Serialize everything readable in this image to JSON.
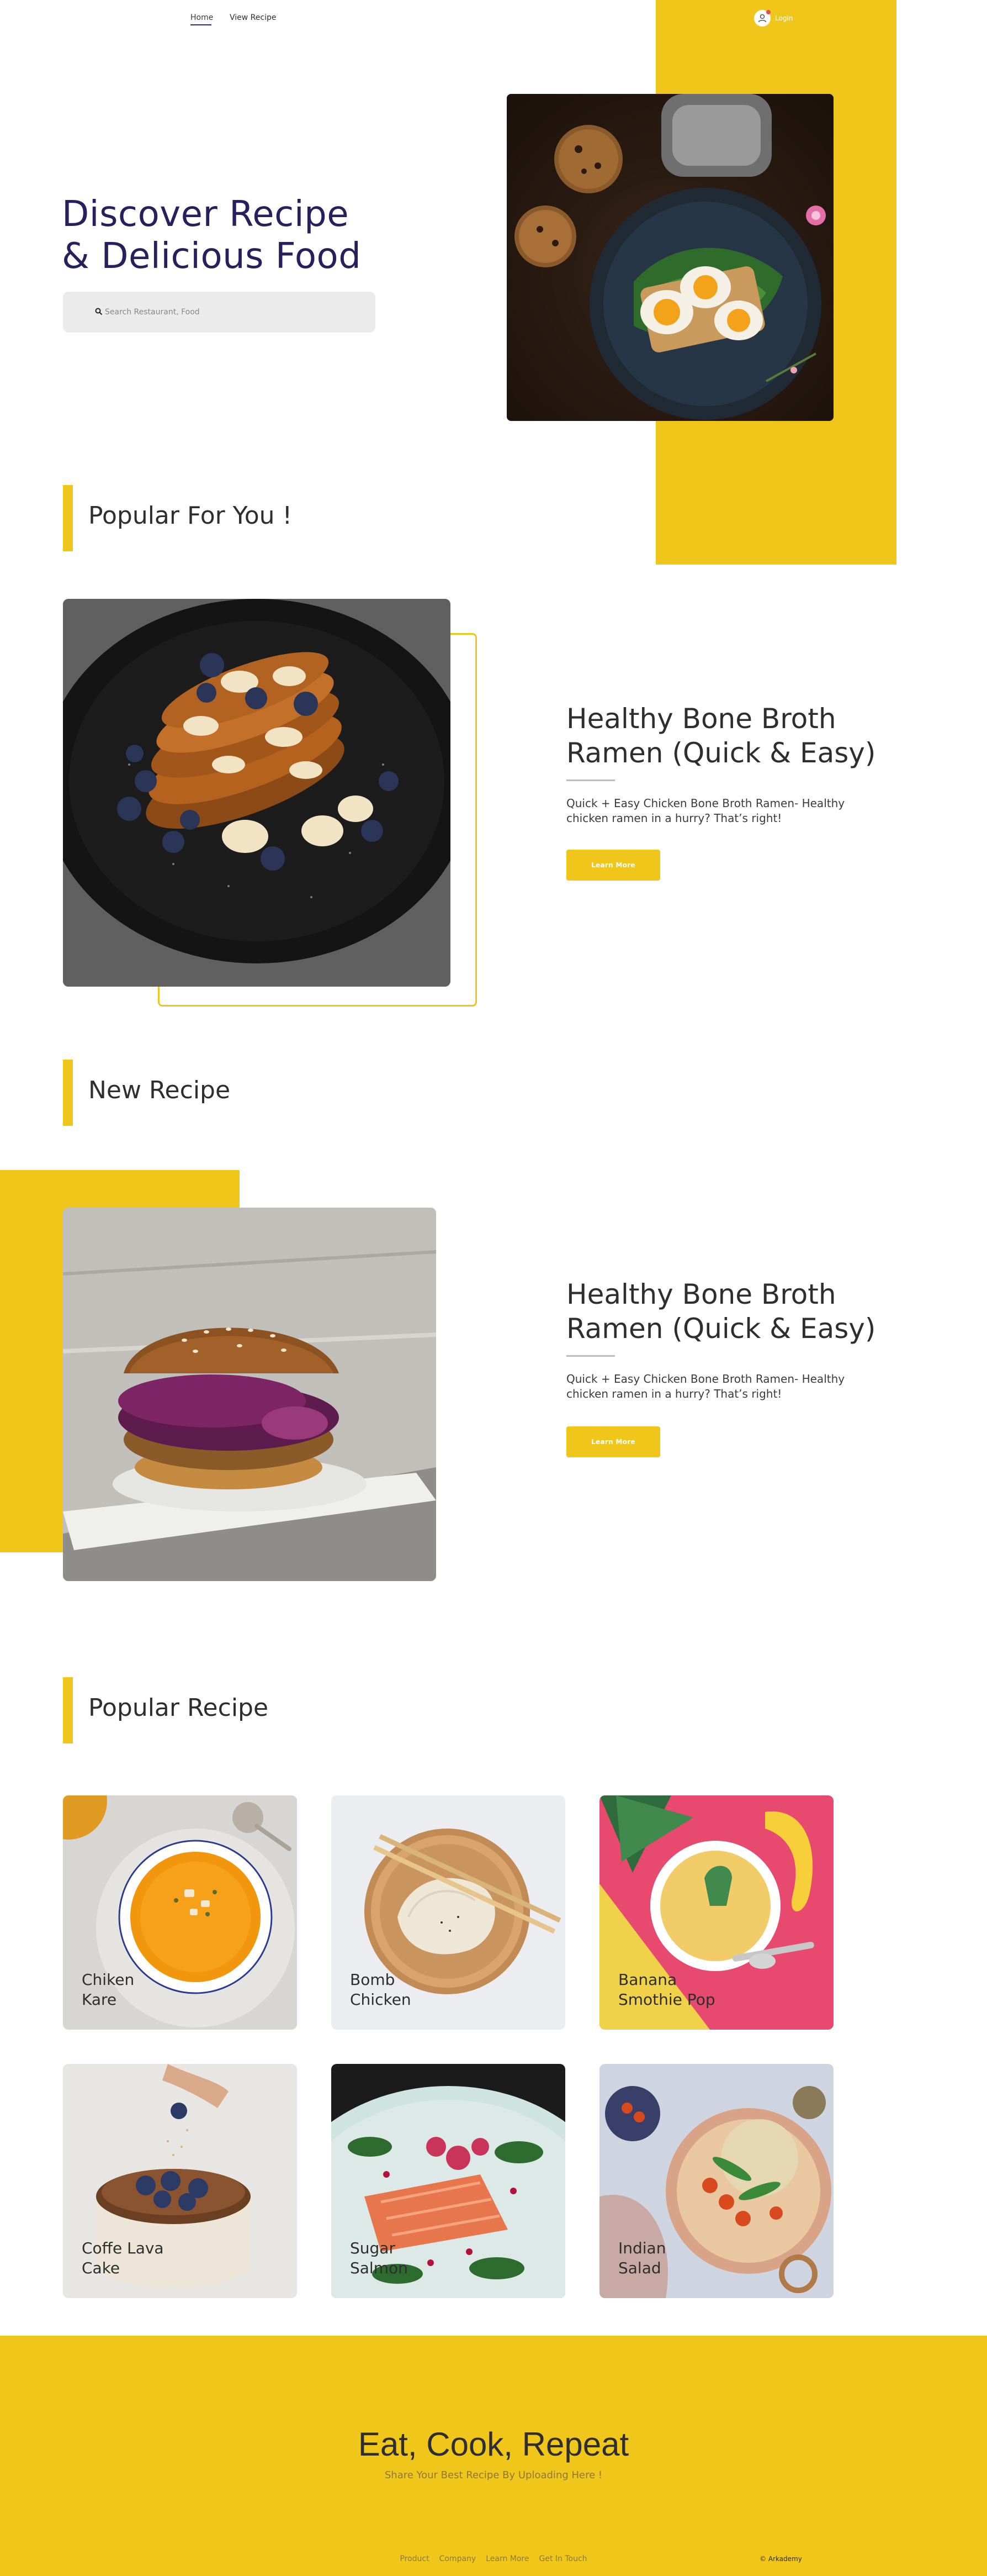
{
  "nav": {
    "links": [
      {
        "label": "Home"
      },
      {
        "label": "View Recipe"
      }
    ],
    "login_label": "Login"
  },
  "hero": {
    "title_line1": "Discover Recipe",
    "title_line2": "& Delicious Food",
    "search_placeholder": "Search Restaurant, Food"
  },
  "sections": {
    "popular_for_you": "Popular For You !",
    "new_recipe": "New Recipe",
    "popular_recipe": "Popular Recipe"
  },
  "features": [
    {
      "title_line1": "Healthy Bone Broth",
      "title_line2": "Ramen (Quick & Easy)",
      "desc_line1": "Quick + Easy Chicken Bone Broth Ramen- Healthy",
      "desc_line2": "chicken ramen in a hurry? That’s right!",
      "button": "Learn More"
    },
    {
      "title_line1": "Healthy Bone Broth",
      "title_line2": "Ramen (Quick & Easy)",
      "desc_line1": "Quick + Easy Chicken Bone Broth Ramen- Healthy",
      "desc_line2": "chicken ramen in a hurry? That’s right!",
      "button": "Learn More"
    }
  ],
  "recipes": [
    {
      "line1": "Chiken",
      "line2": "Kare"
    },
    {
      "line1": "Bomb",
      "line2": "Chicken"
    },
    {
      "line1": "Banana",
      "line2": "Smothie Pop"
    },
    {
      "line1": "Coffe Lava",
      "line2": "Cake"
    },
    {
      "line1": "Sugar",
      "line2": "Salmon"
    },
    {
      "line1": "Indian",
      "line2": "Salad"
    }
  ],
  "footer": {
    "title": "Eat, Cook, Repeat",
    "subtitle": "Share Your Best Recipe By Uploading Here !",
    "links": [
      "Product",
      "Company",
      "Learn More",
      "Get In Touch"
    ],
    "copyright": "© Arkademy"
  },
  "colors": {
    "accent": "#f0c61b",
    "heading": "#26215c",
    "text": "#2e2e2e"
  },
  "icons": [
    "search-icon",
    "user-icon"
  ]
}
